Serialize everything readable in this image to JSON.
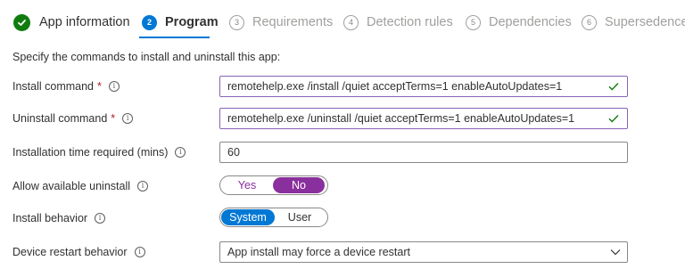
{
  "steps": [
    {
      "label": "App information",
      "number": "",
      "state": "done"
    },
    {
      "label": "Program",
      "number": "2",
      "state": "active"
    },
    {
      "label": "Requirements",
      "number": "3",
      "state": "pending"
    },
    {
      "label": "Detection rules",
      "number": "4",
      "state": "pending"
    },
    {
      "label": "Dependencies",
      "number": "5",
      "state": "pending"
    },
    {
      "label": "Supersedence",
      "number": "6",
      "state": "pending"
    }
  ],
  "intro": "Specify the commands to install and uninstall this app:",
  "install_command": {
    "label": "Install command",
    "required_marker": "*",
    "value": "remotehelp.exe /install /quiet acceptTerms=1 enableAutoUpdates=1"
  },
  "uninstall_command": {
    "label": "Uninstall command",
    "required_marker": "*",
    "value": "remotehelp.exe /uninstall /quiet acceptTerms=1 enableAutoUpdates=1"
  },
  "install_time": {
    "label": "Installation time required (mins)",
    "value": "60"
  },
  "allow_uninstall": {
    "label": "Allow available uninstall",
    "options": [
      "Yes",
      "No"
    ],
    "selected": "No"
  },
  "install_behavior": {
    "label": "Install behavior",
    "options": [
      "System",
      "User"
    ],
    "selected": "System"
  },
  "restart_behavior": {
    "label": "Device restart behavior",
    "value": "App install may force a device restart"
  },
  "info_glyph": "i",
  "colors": {
    "accent_blue": "#0078d4",
    "success_green": "#107c10",
    "toggle_purple": "#8a2f9e",
    "focus_border": "#8764b8",
    "required_red": "#a4262c"
  },
  "icons": {
    "completed_step": "check-circle-icon",
    "valid_field": "checkmark-icon",
    "info": "info-icon",
    "dropdown": "chevron-down-icon"
  }
}
